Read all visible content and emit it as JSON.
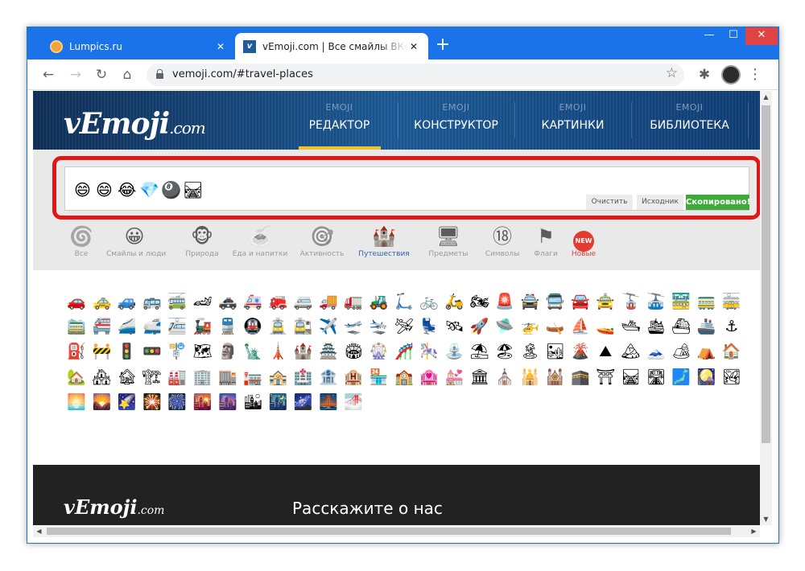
{
  "browser": {
    "tabs": [
      {
        "title": "Lumpics.ru",
        "close": "✕"
      },
      {
        "title": "vEmoji.com | Все смайлы ВКонтакте",
        "close": "✕"
      }
    ],
    "new_tab": "+",
    "window_controls": {
      "minimize": "—",
      "maximize": "☐",
      "close": "✕"
    },
    "nav": {
      "back": "←",
      "forward": "→",
      "reload": "↻",
      "home": "⌂"
    },
    "url": "vemoji.com/#travel-places",
    "bookmark_star": "☆",
    "extensions": "✱",
    "menu": "⋮"
  },
  "site": {
    "logo_main": "vEmoji",
    "logo_suffix": ".com",
    "nav": [
      {
        "small": "EMOJI",
        "label": "РЕДАКТОР"
      },
      {
        "small": "EMOJI",
        "label": "КОНСТРУКТОР"
      },
      {
        "small": "EMOJI",
        "label": "КАРТИНКИ"
      },
      {
        "small": "EMOJI",
        "label": "БИБЛИОТЕКА"
      }
    ],
    "active_nav": 0
  },
  "editor": {
    "emojis": [
      "😄",
      "😄",
      "😂",
      "💎",
      "🎱",
      "🛤"
    ],
    "buttons": {
      "clear": "Очистить",
      "source": "Исходник",
      "copied": "Скопировано!"
    }
  },
  "categories": [
    {
      "icon": "🌀",
      "label": "Все"
    },
    {
      "icon": "😀",
      "label": "Смайлы и люди"
    },
    {
      "icon": "🐵",
      "label": "Природа"
    },
    {
      "icon": "🍝",
      "label": "Еда и напитки"
    },
    {
      "icon": "🎯",
      "label": "Активность"
    },
    {
      "icon": "🏰",
      "label": "Путешествия"
    },
    {
      "icon": "🖥",
      "label": "Предметы"
    },
    {
      "icon": "⑱",
      "label": "Символы"
    },
    {
      "icon": "⚑",
      "label": "Флаги"
    },
    {
      "icon": "NEW",
      "label": "Новые"
    }
  ],
  "active_category": 5,
  "emoji_grid": [
    "🚗",
    "🚕",
    "🚙",
    "🚌",
    "🚎",
    "🏎",
    "🚓",
    "🚑",
    "🚒",
    "🚐",
    "🚚",
    "🚛",
    "🚜",
    "🛴",
    "🚲",
    "🛵",
    "🏍",
    "🚨",
    "🚔",
    "🚍",
    "🚘",
    "🚖",
    "🚡",
    "🚠",
    "🚟",
    "🚃",
    "🚋",
    "🚞",
    "🚝",
    "🚄",
    "🚅",
    "🚈",
    "🚂",
    "🚆",
    "🚇",
    "🚊",
    "🚉",
    "✈️",
    "🛫",
    "🛬",
    "🛩",
    "💺",
    "🛰",
    "🚀",
    "🛸",
    "🚁",
    "🛶",
    "⛵",
    "🚤",
    "🛥",
    "🛳",
    "⛴",
    "🚢",
    "⚓",
    "⛽",
    "🚧",
    "🚦",
    "🚥",
    "🚏",
    "🗺",
    "🗿",
    "🗽",
    "🗼",
    "🏰",
    "🏯",
    "🏟",
    "🎡",
    "🎢",
    "🎠",
    "⛲",
    "⛱",
    "🏖",
    "🏝",
    "🏜",
    "🌋",
    "⛰",
    "🏔",
    "🗻",
    "🏕",
    "⛺",
    "🏠",
    "🏡",
    "🏘",
    "🏚",
    "🏗",
    "🏭",
    "🏢",
    "🏬",
    "🏣",
    "🏤",
    "🏥",
    "🏦",
    "🏨",
    "🏪",
    "🏫",
    "🏩",
    "💒",
    "🏛",
    "⛪",
    "🕌",
    "🕍",
    "🕋",
    "⛩",
    "🛤",
    "🛣",
    "🗾",
    "🎑",
    "🏞",
    "🌅",
    "🌄",
    "🌠",
    "🎇",
    "🎆",
    "🌇",
    "🌆",
    "🏙",
    "🌃",
    "🌌",
    "🌉",
    "🌁"
  ],
  "footer": {
    "logo_main": "vEmoji",
    "logo_suffix": ".com",
    "text": "Расскажите о нас"
  },
  "scroll": {
    "up": "▲",
    "down": "▼",
    "left": "◀",
    "right": "▶"
  }
}
